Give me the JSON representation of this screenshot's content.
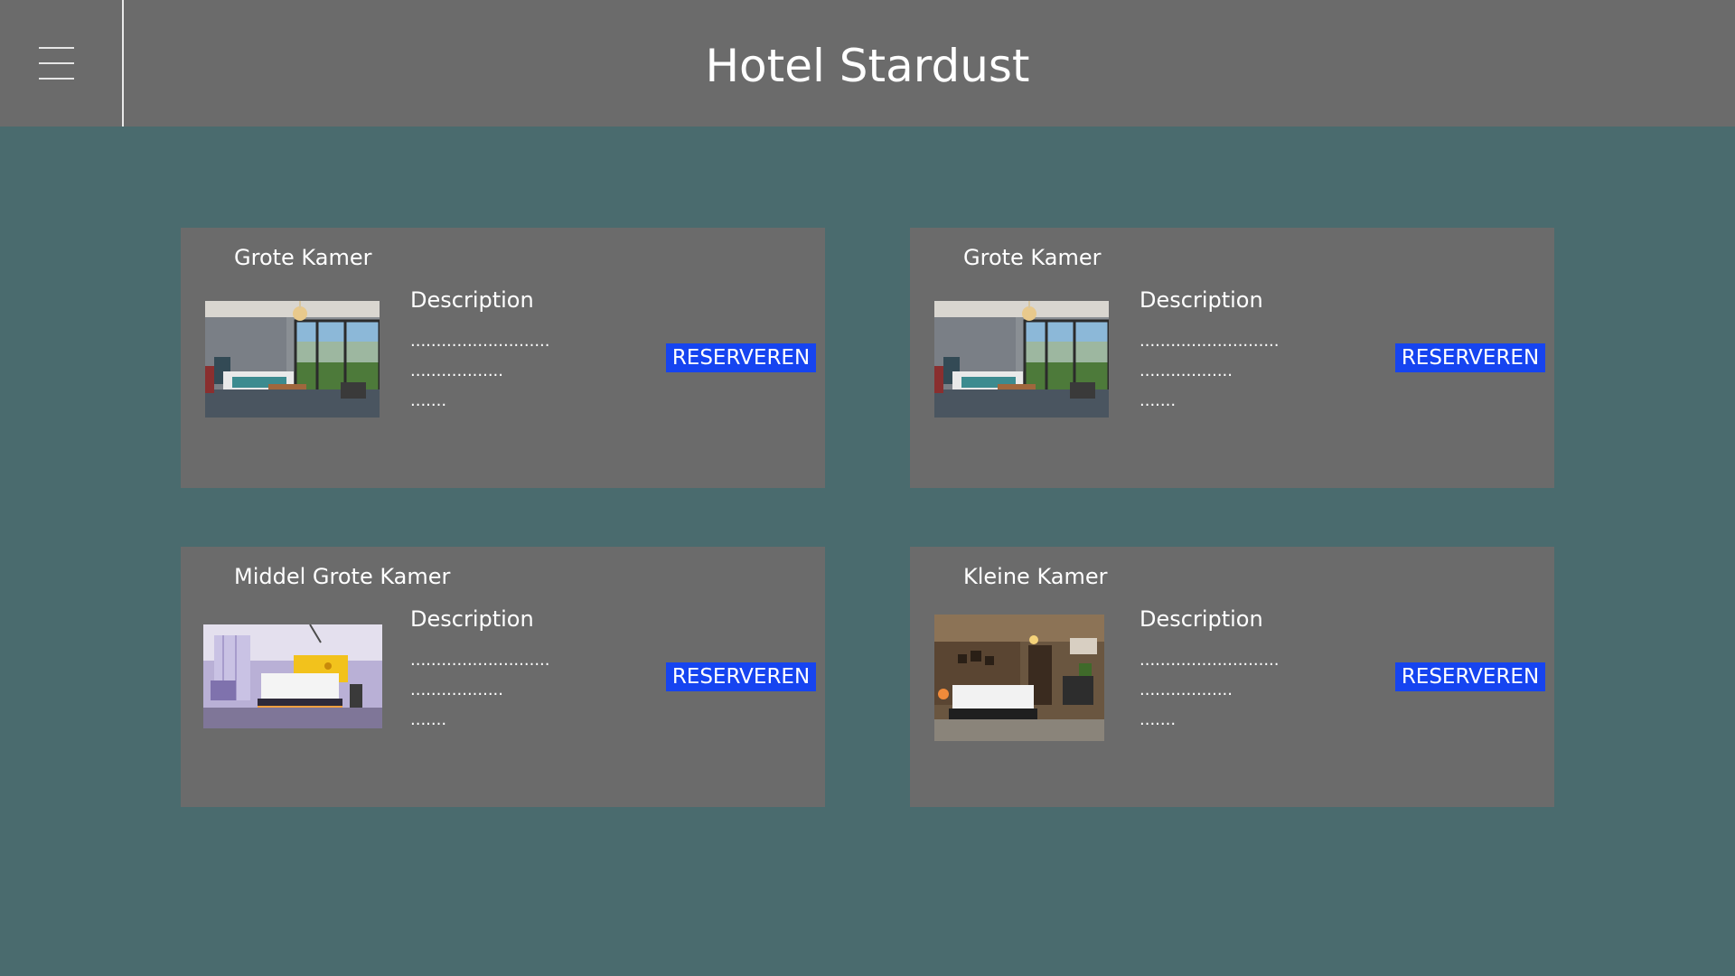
{
  "header": {
    "title": "Hotel Stardust",
    "menu_icon": "hamburger-menu-icon"
  },
  "rooms": [
    {
      "title": "Grote Kamer",
      "description_label": "Description",
      "lines": [
        "...........................",
        "..................",
        "......."
      ],
      "button_label": "RESERVEREN",
      "image": "hotel-room-with-window-photo"
    },
    {
      "title": "Grote Kamer",
      "description_label": "Description",
      "lines": [
        "...........................",
        "..................",
        "......."
      ],
      "button_label": "RESERVEREN",
      "image": "hotel-room-with-window-photo"
    },
    {
      "title": "Middel Grote Kamer",
      "description_label": "Description",
      "lines": [
        "...........................",
        "..................",
        "......."
      ],
      "button_label": "RESERVEREN",
      "image": "purple-hotel-room-photo"
    },
    {
      "title": "Kleine Kamer",
      "description_label": "Description",
      "lines": [
        "...........................",
        "..................",
        "......."
      ],
      "button_label": "RESERVEREN",
      "image": "dark-hotel-room-photo"
    }
  ],
  "colors": {
    "background": "#4a6b6e",
    "titlebar": "#6b6b6b",
    "card": "#6b6b6b",
    "button": "#1644f0",
    "text": "#ffffff"
  }
}
